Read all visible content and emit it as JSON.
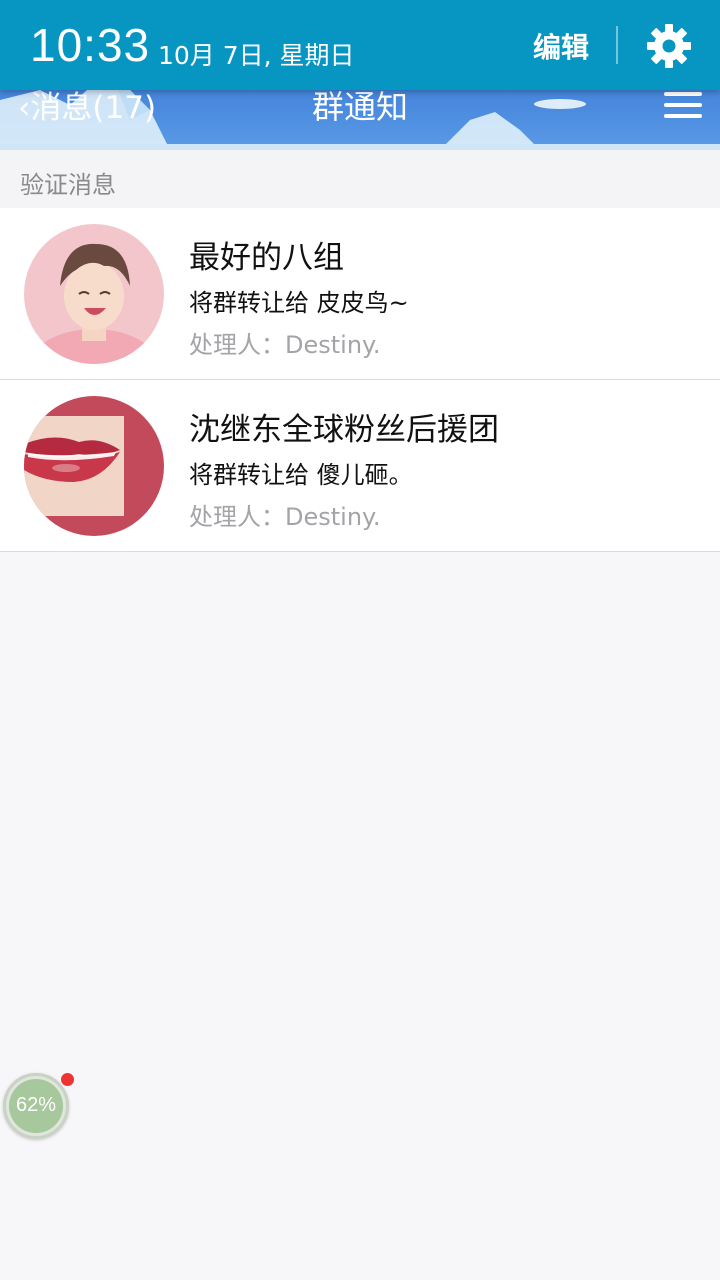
{
  "status_bar": {
    "time": "10:33",
    "date": "10月 7日, 星期日",
    "edit_label": "编辑",
    "settings_icon": "gear-icon"
  },
  "header": {
    "back_label": "消息(17)",
    "title": "群通知",
    "menu_icon": "menu-icon",
    "color": "#4a8ade"
  },
  "section": {
    "label": "验证消息"
  },
  "notifications": [
    {
      "group_name": "最好的八组",
      "action": "将群转让给 皮皮鸟~",
      "handler": "处理人：Destiny."
    },
    {
      "group_name": "沈继东全球粉丝后援团",
      "action": "将群转让给 傻儿砸。",
      "handler": "处理人：Destiny."
    }
  ],
  "floating_widget": {
    "percent": "62%"
  }
}
